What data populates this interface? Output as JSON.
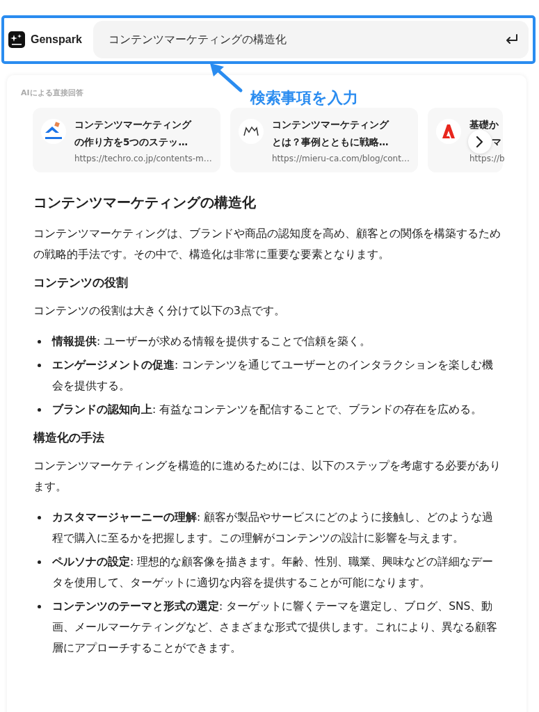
{
  "header": {
    "brand": "Genspark",
    "search": {
      "value": "コンテンツマーケティングの構造化"
    }
  },
  "annotation": {
    "label": "検索事項を入力"
  },
  "answer": {
    "section_label": "AIによる直接回答",
    "sources": [
      {
        "title_lines": [
          "コンテンツマーケティング",
          "の作り方を5つのステッ…"
        ],
        "url": "https://techro.co.jp/contents-m…"
      },
      {
        "title_lines": [
          "コンテンツマーケティング",
          "とは？事例とともに戦略…"
        ],
        "url": "https://mieru-ca.com/blog/cont…"
      },
      {
        "title_lines": [
          "基礎か",
          "マ"
        ],
        "url": "https://b"
      }
    ],
    "title": "コンテンツマーケティングの構造化",
    "blocks": [
      {
        "kind": "paragraph",
        "text": "コンテンツマーケティングは、ブランドや商品の認知度を高め、顧客との関係を構築するための戦略的手法です。その中で、構造化は非常に重要な要素となります。"
      },
      {
        "kind": "heading",
        "text": "コンテンツの役割"
      },
      {
        "kind": "paragraph",
        "text": "コンテンツの役割は大きく分けて以下の3点です。"
      },
      {
        "kind": "list",
        "items": [
          "**情報提供**: ユーザーが求める情報を提供することで信頼を築く。",
          "**エンゲージメントの促進**: コンテンツを通じてユーザーとのインタラクションを楽しむ機会を提供する。",
          "**ブランドの認知向上**: 有益なコンテンツを配信することで、ブランドの存在を広める。"
        ]
      },
      {
        "kind": "heading",
        "text": "構造化の手法"
      },
      {
        "kind": "paragraph",
        "text": "コンテンツマーケティングを構造的に進めるためには、以下のステップを考慮する必要があります。"
      },
      {
        "kind": "list",
        "items": [
          "**カスタマージャーニーの理解**: 顧客が製品やサービスにどのように接触し、どのような過程で購入に至るかを把握します。この理解がコンテンツの設計に影響を与えます。",
          "**ペルソナの設定**: 理想的な顧客像を描きます。年齢、性別、職業、興味などの詳細なデータを使用して、ターゲットに適切な内容を提供することが可能になります。",
          "**コンテンツのテーマと形式の選定**: ターゲットに響くテーマを選定し、ブログ、SNS、動画、メールマーケティングなど、さまざまな形式で提供します。これにより、異なる顧客層にアプローチすることができます。"
        ]
      }
    ]
  }
}
